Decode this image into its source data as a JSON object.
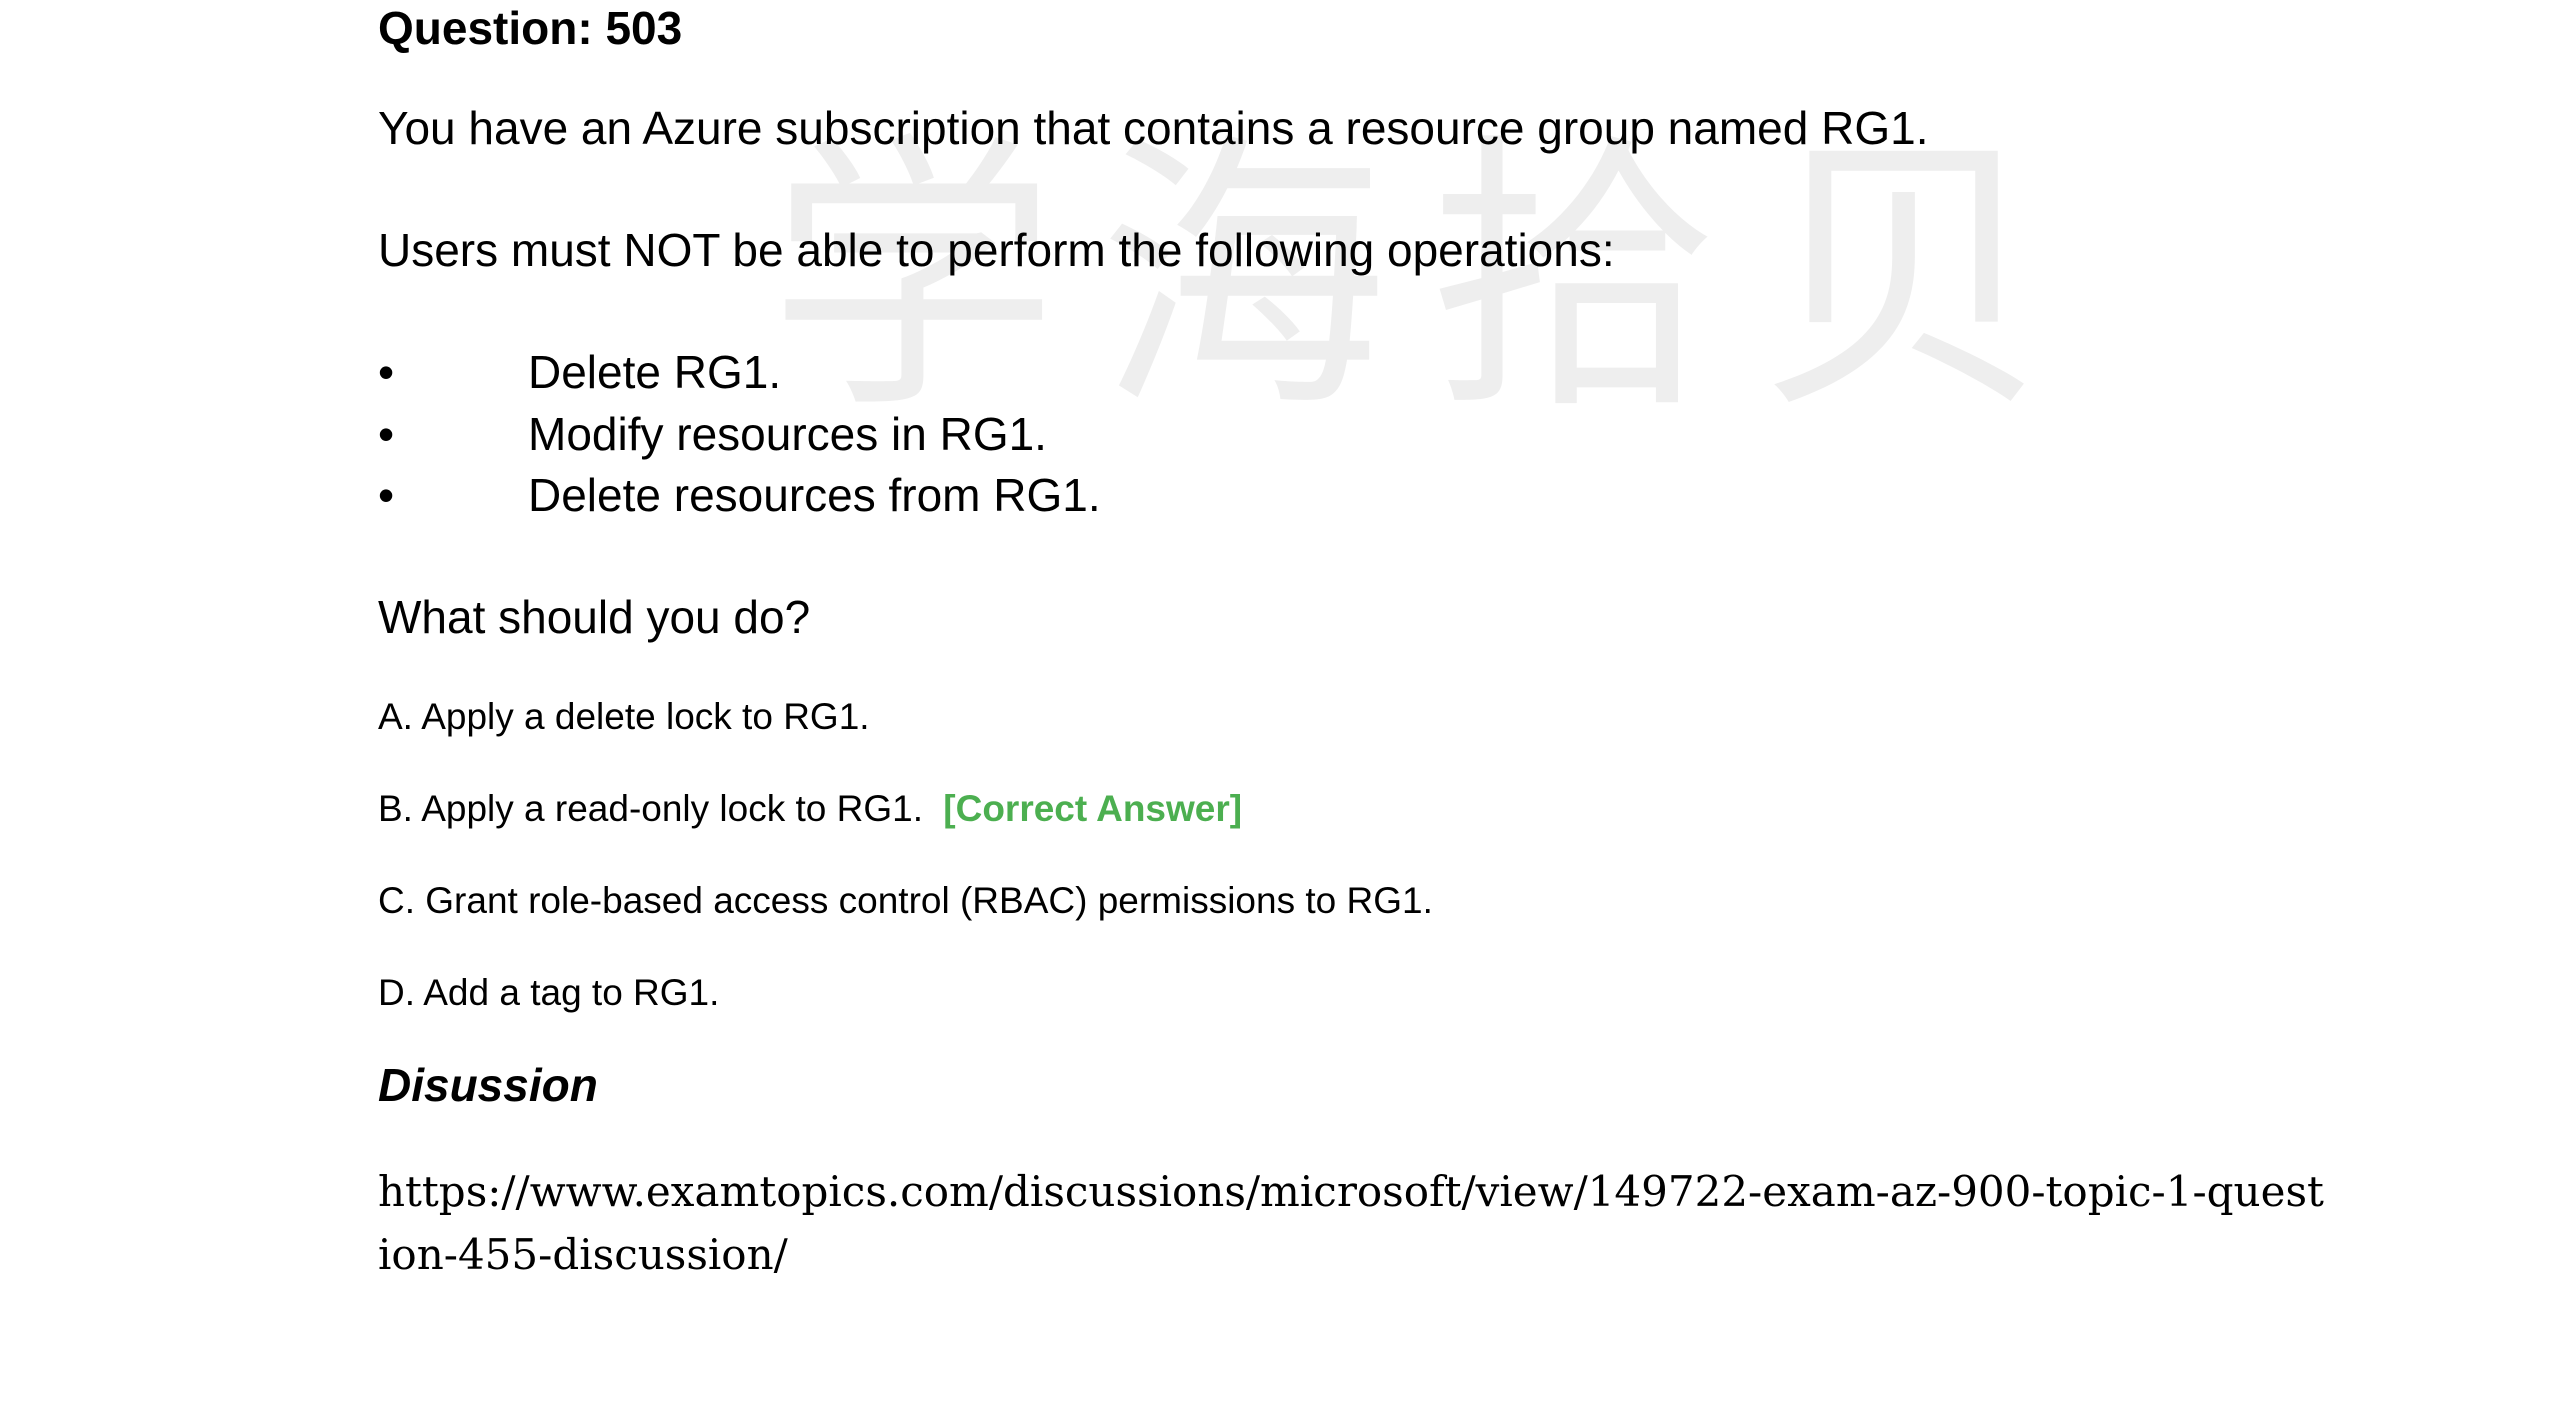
{
  "question": {
    "title": "Question: 503",
    "intro": "You have an Azure subscription that contains a resource group named RG1.",
    "requirement": "Users must NOT be able to perform the following operations:",
    "bullets": [
      "Delete RG1.",
      "Modify resources in RG1.",
      "Delete resources from RG1."
    ],
    "prompt": "What should you do?"
  },
  "options": {
    "a": "A. Apply a delete lock to RG1.",
    "b": "B. Apply a read-only lock to RG1.",
    "b_tag": "[Correct Answer]",
    "c": "C. Grant role-based access control (RBAC) permissions to RG1.",
    "d": "D. Add a tag to RG1."
  },
  "discussion": {
    "title": "Disussion",
    "url": "https://www.examtopics.com/discussions/microsoft/view/149722-exam-az-900-topic-1-question-455-discussion/"
  },
  "watermark": {
    "text": "学海拾贝"
  },
  "colors": {
    "correct_answer": "#4caf50"
  }
}
